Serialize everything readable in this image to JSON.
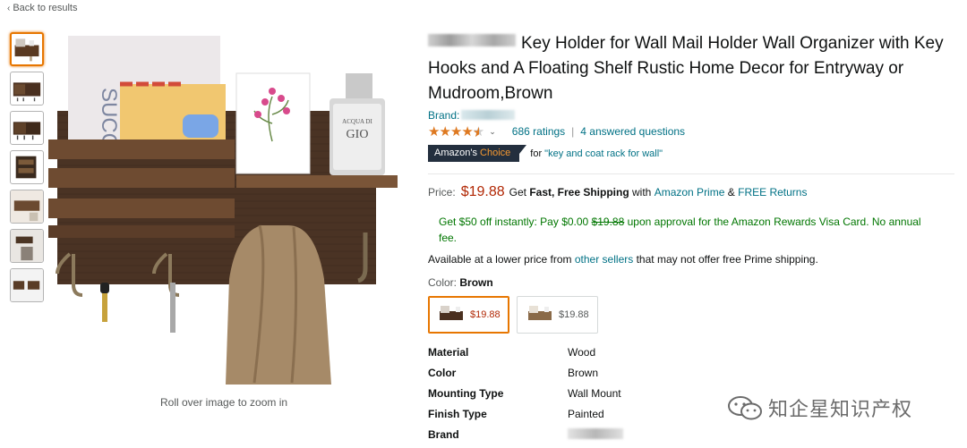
{
  "nav": {
    "back_label": "Back to results"
  },
  "gallery": {
    "thumb_count": 7,
    "zoom_hint": "Roll over image to zoom in",
    "image_text": {
      "bottle_line1": "ACQUA DI",
      "bottle_line2": "GIO"
    }
  },
  "product": {
    "title": "Key Holder for Wall Mail Holder Wall Organizer with Key Hooks and A Floating Shelf Rustic Home Decor for Entryway or Mudroom,Brown",
    "brand_label": "Brand:",
    "rating_stars": 4.5,
    "ratings_label": "686 ratings",
    "answered_label": "4 answered questions",
    "choice": {
      "badge_prefix": "Amazon's",
      "badge_suffix": "Choice",
      "for_label": "for",
      "query": "\"key and coat rack for wall\""
    },
    "price": {
      "label": "Price:",
      "amount": "$19.88",
      "get": "Get",
      "shipping": "Fast, Free Shipping",
      "with": "with",
      "prime": "Amazon Prime",
      "amp": "&",
      "returns": "FREE Returns"
    },
    "promo": {
      "text1": "Get $50 off instantly: Pay $0.00",
      "strike": "$19.88",
      "text2": "upon approval for the Amazon Rewards Visa Card. No annual fee."
    },
    "lower": {
      "text1": "Available at a lower price from",
      "link": "other sellers",
      "text2": "that may not offer free Prime shipping."
    },
    "color": {
      "label": "Color:",
      "value": "Brown"
    },
    "swatches": [
      {
        "price": "$19.88",
        "selected": true
      },
      {
        "price": "$19.88",
        "selected": false
      }
    ],
    "specs": [
      {
        "key": "Material",
        "value": "Wood"
      },
      {
        "key": "Color",
        "value": "Brown"
      },
      {
        "key": "Mounting Type",
        "value": "Wall Mount"
      },
      {
        "key": "Finish Type",
        "value": "Painted"
      },
      {
        "key": "Brand",
        "value": ""
      }
    ]
  },
  "watermark": {
    "text": "知企星知识产权"
  },
  "colors": {
    "accent": "#e77600",
    "link": "#007185",
    "price": "#b12704",
    "promo": "#007600",
    "badge_bg": "#232f3e",
    "star": "#de7921"
  }
}
